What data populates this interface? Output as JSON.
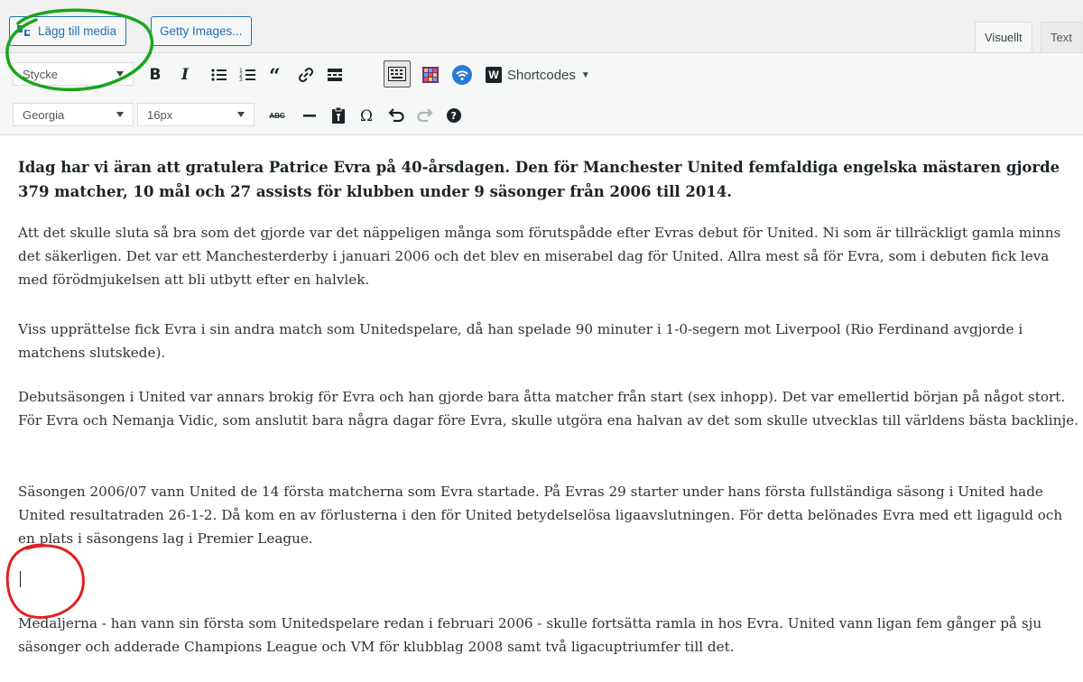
{
  "media_buttons": {
    "add_media": "Lägg till media",
    "getty": "Getty Images..."
  },
  "tabs": {
    "visual": "Visuellt",
    "text": "Text"
  },
  "toolbar": {
    "style_select": "Stycke",
    "font_select": "Georgia",
    "size_select": "16px",
    "bold": "B",
    "italic": "I",
    "shortcodes_label": "Shortcodes",
    "shortcodes_icon_letter": "W",
    "strikethrough": "ABC"
  },
  "annotations": {
    "green_color": "#1aa51a",
    "red_color": "#e02020"
  },
  "content": {
    "lead": "Idag har vi äran att gratulera Patrice Evra på 40-årsdagen. Den för Manchester United femfaldiga engelska mästaren gjorde 379 matcher, 10 mål och 27 assists för klubben under 9 säsonger från 2006 till 2014.",
    "p1": "Att det skulle sluta så bra som det gjorde var det näppeligen många som förutspådde efter Evras debut för United. Ni som är tillräckligt gamla minns det säkerligen. Det var ett Manchesterderby i januari 2006 och det blev en miserabel dag för United. Allra mest så för Evra, som i debuten fick leva med förödmjukelsen att bli utbytt efter en halvlek.",
    "p2": "Viss upprättelse fick Evra i sin andra match som Unitedspelare, då han spelade 90 minuter i 1-0-segern mot Liverpool (Rio Ferdinand avgjorde i matchens slutskede).",
    "p3": "Debutsäsongen i United var annars brokig för Evra och han gjorde bara åtta matcher från start (sex inhopp). Det var emellertid början på något stort. För Evra och Nemanja Vidic, som anslutit bara några dagar före Evra, skulle utgöra ena halvan av det som skulle utvecklas till världens bästa backlinje.",
    "p4": "Säsongen 2006/07 vann United de 14 första matcherna som Evra startade. På Evras 29 starter under hans första fullständiga säsong i United hade United resultatraden 26-1-2. Då kom en av förlusterna i den för United betydelselösa ligaavslutningen. För detta belönades Evra med ett ligaguld och en plats i säsongens lag i Premier League.",
    "p5": "Medaljerna - han vann sin första som Unitedspelare redan i februari 2006 - skulle fortsätta ramla in hos Evra. United vann ligan fem gånger på sju säsonger och adderade Champions League och VM för klubblag 2008 samt två ligacuptriumfer till det."
  }
}
